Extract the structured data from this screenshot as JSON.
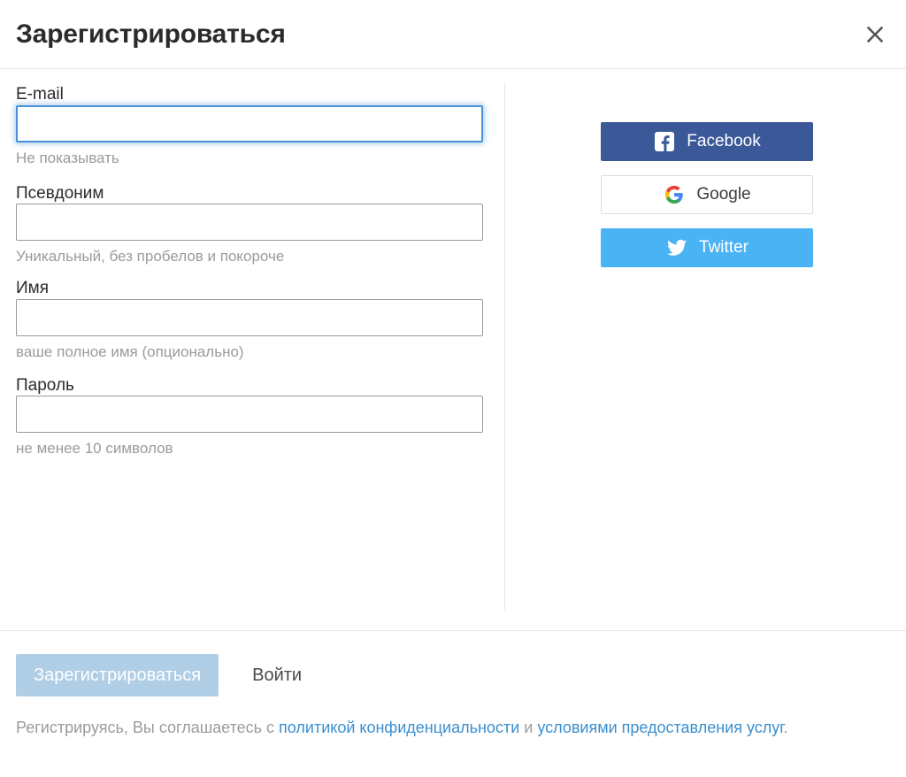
{
  "dialog": {
    "title": "Зарегистрироваться",
    "close_icon": "close-icon"
  },
  "form": {
    "fields": [
      {
        "label": "E-mail",
        "value": "",
        "hint": "Не показывать",
        "focused": true,
        "type": "email"
      },
      {
        "label": "Псевдоним",
        "value": "",
        "hint": "Уникальный, без пробелов и покороче",
        "focused": false,
        "type": "text"
      },
      {
        "label": "Имя",
        "value": "",
        "hint": "ваше полное имя (опционально)",
        "focused": false,
        "type": "text"
      },
      {
        "label": "Пароль",
        "value": "",
        "hint": "не менее 10 символов",
        "focused": false,
        "type": "password"
      }
    ]
  },
  "social": {
    "buttons": [
      {
        "label": "Facebook",
        "icon": "facebook-icon",
        "color": "#3b5998",
        "text_color": "#ffffff"
      },
      {
        "label": "Google",
        "icon": "google-icon",
        "color": "#ffffff",
        "text_color": "#3c3c3c"
      },
      {
        "label": "Twitter",
        "icon": "twitter-icon",
        "color": "#4ab3f4",
        "text_color": "#ffffff"
      }
    ]
  },
  "footer": {
    "submit_label": "Зарегистрироваться",
    "submit_color": "#b0cee6",
    "login_label": "Войти",
    "terms": {
      "prefix": "Регистрируясь, Вы соглашаетесь с ",
      "link1": "политикой конфиденциальности",
      "middle": " и ",
      "link2": "условиями предоставления услуг",
      "suffix": ".",
      "link_color": "#3a8fd0"
    }
  }
}
